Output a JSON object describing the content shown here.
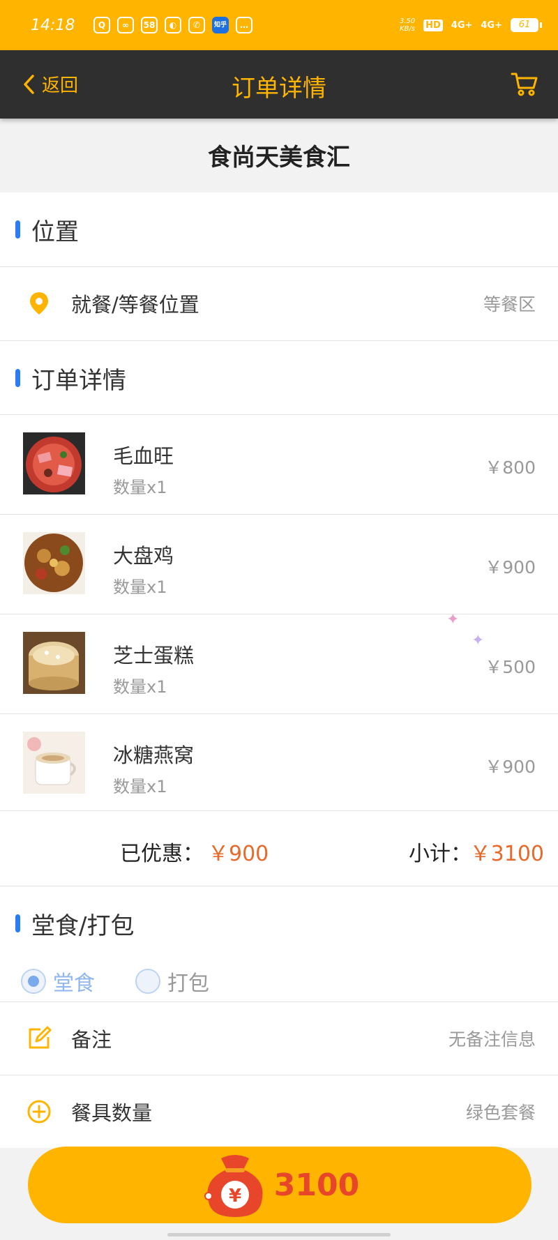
{
  "status_bar": {
    "time": "14:18",
    "apps": [
      "qq-icon",
      "baidu-icon",
      "58",
      "weibo-icon",
      "phone-icon",
      "知乎",
      "chat-icon"
    ],
    "net_speed_value": "3.50",
    "net_speed_unit": "KB/s",
    "hd": "HD",
    "signal_1": "4G+",
    "signal_2": "4G+",
    "battery": "61"
  },
  "nav": {
    "back_label": "返回",
    "title": "订单详情",
    "cart_icon": "cart-icon"
  },
  "shop": {
    "name": "食尚天美食汇"
  },
  "location": {
    "section_title": "位置",
    "label": "就餐/等餐位置",
    "value": "等餐区"
  },
  "order": {
    "section_title": "订单详情",
    "items": [
      {
        "name": "毛血旺",
        "qty": "数量x1",
        "price": "￥800"
      },
      {
        "name": "大盘鸡",
        "qty": "数量x1",
        "price": "￥900"
      },
      {
        "name": "芝士蛋糕",
        "qty": "数量x1",
        "price": "￥500"
      },
      {
        "name": "冰糖燕窝",
        "qty": "数量x1",
        "price": "￥900"
      }
    ],
    "discount_label": "已优惠：",
    "discount_value": "￥900",
    "subtotal_label": "小计：",
    "subtotal_value": "￥3100"
  },
  "dine": {
    "section_title": "堂食/打包",
    "options": [
      "堂食",
      "打包"
    ],
    "selected": "堂食"
  },
  "remark": {
    "label": "备注",
    "value": "无备注信息"
  },
  "tableware": {
    "label": "餐具数量",
    "value": "绿色套餐"
  },
  "pay": {
    "symbol": "¥",
    "amount": "3100"
  },
  "colors": {
    "brand": "#ffb400",
    "nav_bg": "#2f2f2f",
    "price_accent": "#e8692a",
    "section_bar": "#2a7cf5"
  }
}
